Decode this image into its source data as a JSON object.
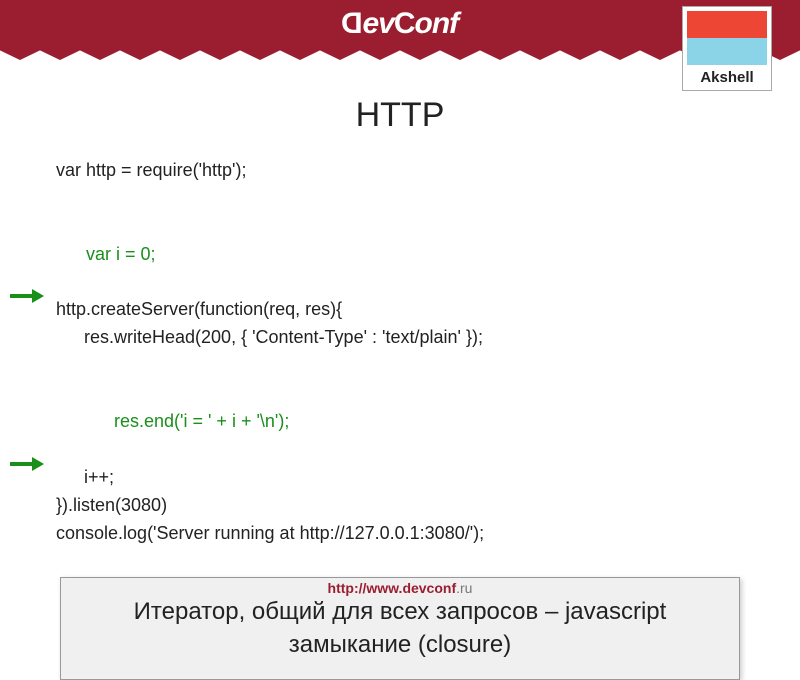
{
  "header": {
    "brand": "DevConf"
  },
  "sponsor": {
    "label": "Akshell"
  },
  "slide": {
    "title": "HTTP",
    "code": {
      "l1": "var http = require('http');",
      "l2": "var i = 0;",
      "l3": "http.createServer(function(req, res){",
      "l4": "res.writeHead(200, { 'Content-Type' : 'text/plain' });",
      "l5": "res.end('i = ' + i + '\\n');",
      "l6": "i++;",
      "l7": "}).listen(3080)",
      "l8": "console.log('Server running at http://127.0.0.1:3080/');"
    },
    "callout": "Итератор, общий для всех запросов – javascript замыкание (closure)"
  },
  "footer": {
    "url_prefix": "http://www.",
    "url_domain": "devconf",
    "url_suffix": ".ru"
  }
}
